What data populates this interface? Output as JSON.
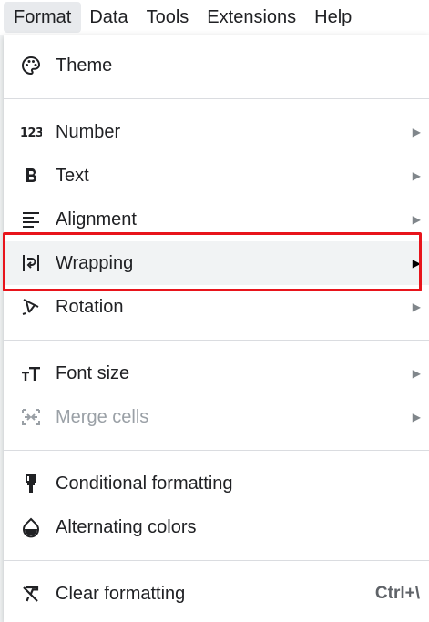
{
  "menubar": {
    "items": [
      "Format",
      "Data",
      "Tools",
      "Extensions",
      "Help"
    ],
    "active_index": 0
  },
  "menu": {
    "theme": {
      "label": "Theme",
      "icon": "palette-icon"
    },
    "number": {
      "label": "Number",
      "icon": "number-123-icon"
    },
    "text": {
      "label": "Text",
      "icon": "bold-b-icon"
    },
    "alignment": {
      "label": "Alignment",
      "icon": "align-left-icon"
    },
    "wrapping": {
      "label": "Wrapping",
      "icon": "text-wrap-icon"
    },
    "rotation": {
      "label": "Rotation",
      "icon": "text-rotation-icon"
    },
    "font_size": {
      "label": "Font size",
      "icon": "font-size-icon"
    },
    "merge_cells": {
      "label": "Merge cells",
      "icon": "merge-cells-icon"
    },
    "conditional_formatting": {
      "label": "Conditional formatting",
      "icon": "paint-roller-icon"
    },
    "alternating_colors": {
      "label": "Alternating colors",
      "icon": "color-drop-icon"
    },
    "clear_formatting": {
      "label": "Clear formatting",
      "icon": "clear-format-icon",
      "shortcut": "Ctrl+\\"
    }
  },
  "submenu_arrow": "▶",
  "colors": {
    "highlight_border": "#e8141b",
    "hover_background": "#f1f3f4",
    "active_menubar": "#e8eaed",
    "disabled_text": "#9aa0a6"
  }
}
